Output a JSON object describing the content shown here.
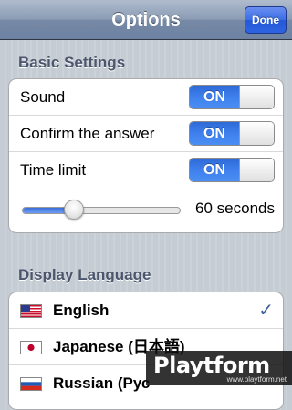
{
  "navbar": {
    "title": "Options",
    "done_label": "Done"
  },
  "basic_settings": {
    "header": "Basic Settings",
    "sound": {
      "label": "Sound",
      "state": "ON"
    },
    "confirm": {
      "label": "Confirm the answer",
      "state": "ON"
    },
    "time_limit": {
      "label": "Time limit",
      "state": "ON"
    },
    "slider": {
      "value_label": "60 seconds",
      "fraction": 0.33
    }
  },
  "display_language": {
    "header": "Display Language",
    "items": [
      {
        "label": "English",
        "flag": "us-flag-icon",
        "selected": true,
        "check": "✓"
      },
      {
        "label": "Japanese (日本語)",
        "flag": "japan-flag-icon",
        "selected": false
      },
      {
        "label": "Russian (Рус",
        "flag": "russia-flag-icon",
        "selected": false
      }
    ]
  },
  "watermark": {
    "brand": "Playtform",
    "url": "www.playtform.net"
  },
  "colors": {
    "accent": "#2458d8",
    "toggle_on": "#3f80ee",
    "check": "#3f5ea0"
  }
}
